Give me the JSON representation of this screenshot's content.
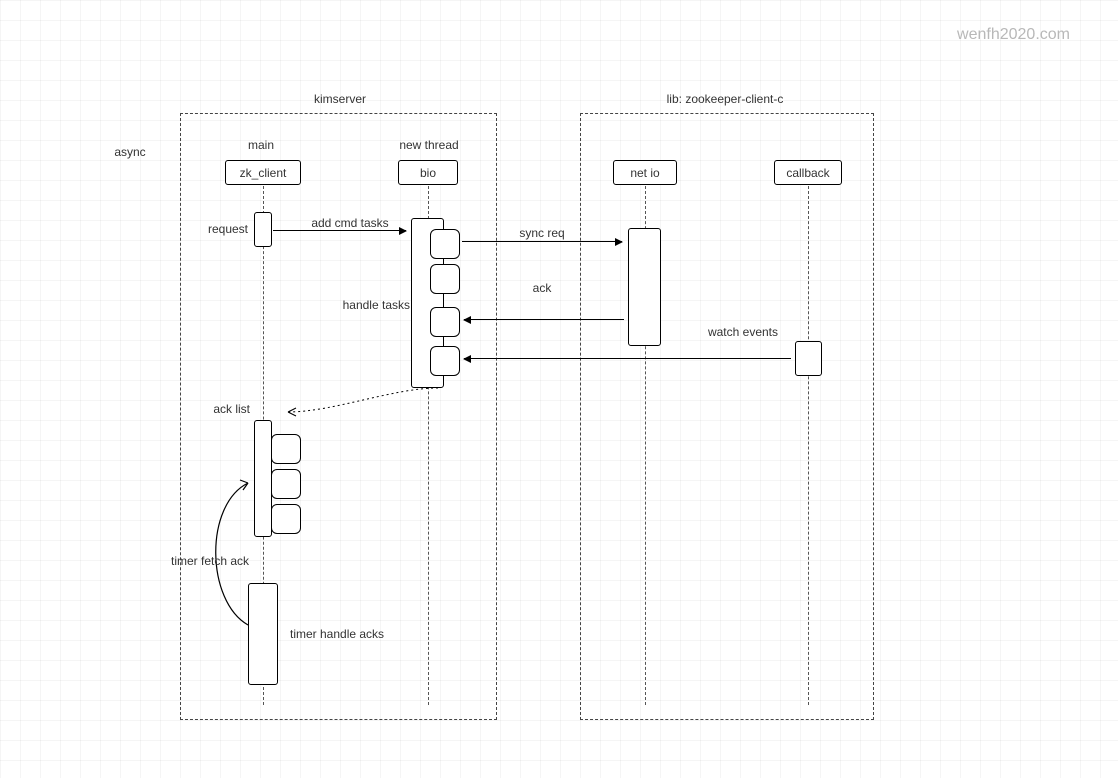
{
  "watermark": "wenfh2020.com",
  "titles": {
    "async": "async",
    "kimserver": "kimserver",
    "zk_lib": "lib: zookeeper-client-c",
    "main": "main",
    "new_thread": "new thread"
  },
  "lanes": {
    "zk_client": "zk_client",
    "bio": "bio",
    "net_io": "net io",
    "callback": "callback"
  },
  "labels": {
    "request": "request",
    "add_cmd_tasks": "add cmd tasks",
    "sync_req": "sync req",
    "ack": "ack",
    "handle_tasks": "handle tasks",
    "watch_events": "watch events",
    "ack_list": "ack list",
    "timer_fetch_ack": "timer fetch ack",
    "timer_handle_acks": "timer handle acks"
  }
}
